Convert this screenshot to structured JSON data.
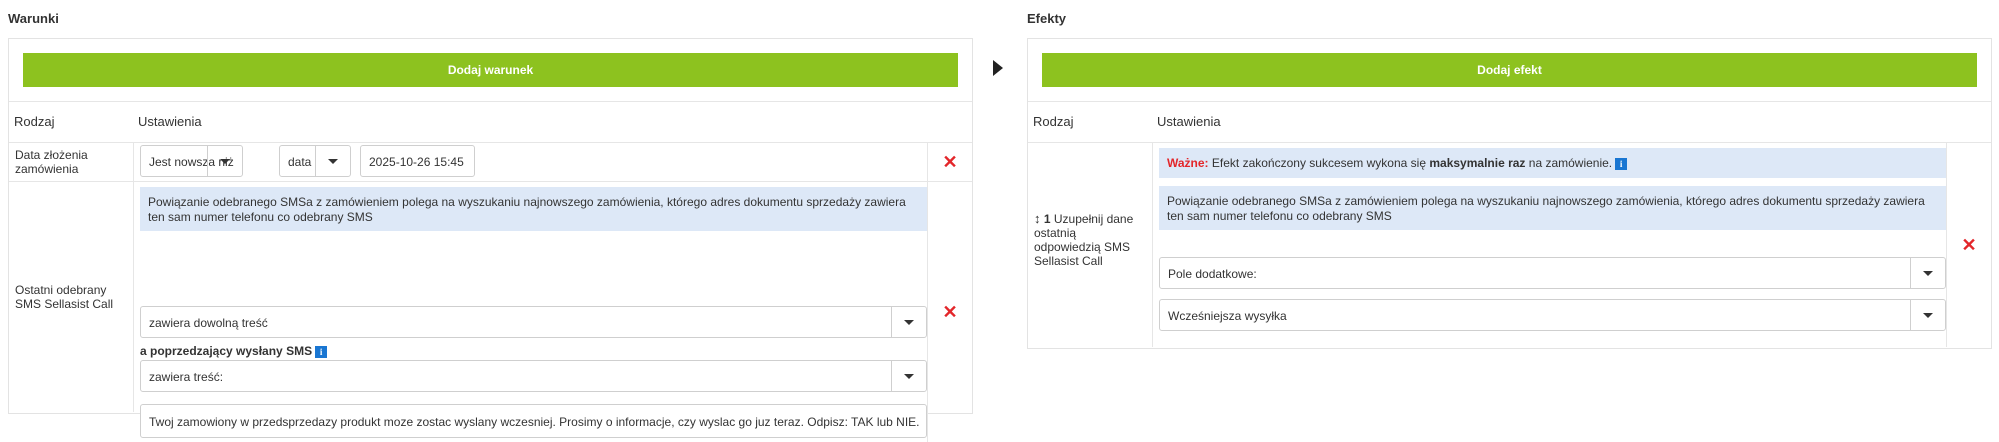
{
  "conditions": {
    "title": "Warunki",
    "add_button": "Dodaj warunek",
    "col_kind": "Rodzaj",
    "col_settings": "Ustawienia",
    "row1": {
      "kind": "Data złożenia zamówienia",
      "operator": "Jest nowsza niż",
      "type": "data",
      "date": "2025-10-26 15:45"
    },
    "row2": {
      "kind": "Ostatni odebrany SMS Sellasist Call",
      "info": "Powiązanie odebranego SMSa z zamówieniem polega na wyszukaniu najnowszego zamówienia, którego adres dokumentu sprzedaży zawiera ten sam numer telefonu co odebrany SMS",
      "content_select": "zawiera dowolną treść",
      "prev_label": "a poprzedzający wysłany SMS",
      "prev_select": "zawiera treść:",
      "prev_text": "Twoj zamowiony w przedsprzedazy produkt moze zostac wyslany wczesniej. Prosimy o informacje, czy wyslac go juz teraz. Odpisz: TAK lub NIE."
    }
  },
  "effects": {
    "title": "Efekty",
    "add_button": "Dodaj efekt",
    "col_kind": "Rodzaj",
    "col_settings": "Ustawienia",
    "row1": {
      "order_num": "1",
      "kind": "Uzupełnij dane ostatnią odpowiedzią SMS Sellasist Call",
      "warn_label": "Ważne:",
      "warn_text_a": "Efekt zakończony sukcesem wykona się",
      "warn_bold": "maksymalnie raz",
      "warn_text_b": "na zamówienie.",
      "info": "Powiązanie odebranego SMSa z zamówieniem polega na wyszukaniu najnowszego zamówienia, którego adres dokumentu sprzedaży zawiera ten sam numer telefonu co odebrany SMS",
      "field_select": "Pole dodatkowe:",
      "value_select": "Wcześniejsza wysyłka"
    }
  },
  "icons": {
    "info": "i",
    "delete": "✕"
  },
  "colors": {
    "accent_green": "#8dc21f",
    "info_bg": "#dde8f7",
    "delete_red": "#e3262a",
    "warn_red": "#e3262a",
    "info_icon": "#1976d2"
  }
}
